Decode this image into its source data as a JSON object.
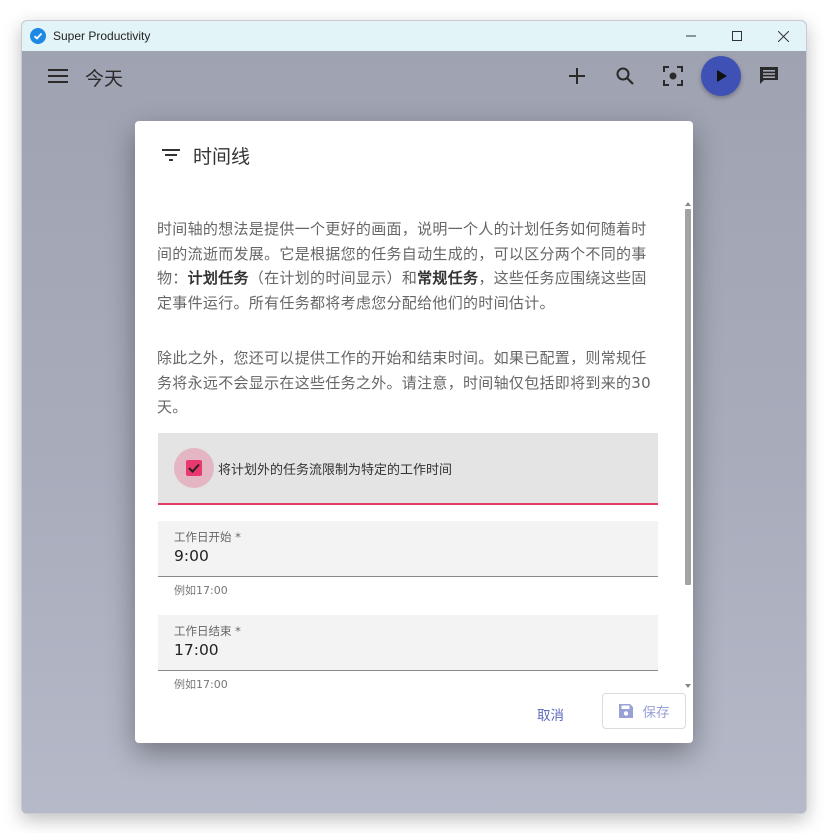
{
  "window": {
    "title": "Super Productivity"
  },
  "topbar": {
    "page_title": "今天"
  },
  "dialog": {
    "title": "时间线",
    "paragraph1": {
      "t1": "时间轴的想法是提供一个更好的画面，说明一个人的计划任务如何随着时间的流逝而发展。它是根据您的任务自动生成的，可以区分两个不同的事物：",
      "b1": "计划任务",
      "t2": "（在计划的时间显示）和",
      "b2": "常规任务",
      "t3": "，这些任务应围绕这些固定事件运行。所有任务都将考虑您分配给他们的时间估计。"
    },
    "paragraph2": "除此之外，您还可以提供工作的开始和结束时间。如果已配置，则常规任务将永远不会显示在这些任务之外。请注意，时间轴仅包括即将到来的30天。",
    "checkbox": {
      "label": "将计划外的任务流限制为特定的工作时间",
      "checked": true
    },
    "start_field": {
      "label": "工作日开始 *",
      "value": "9:00",
      "hint": "例如17:00"
    },
    "end_field": {
      "label": "工作日结束 *",
      "value": "17:00",
      "hint": "例如17:00"
    },
    "actions": {
      "cancel": "取消",
      "save": "保存"
    }
  },
  "colors": {
    "accent": "#e8386d",
    "primary": "#3f51b5",
    "titlebar": "#e3f4f8"
  }
}
